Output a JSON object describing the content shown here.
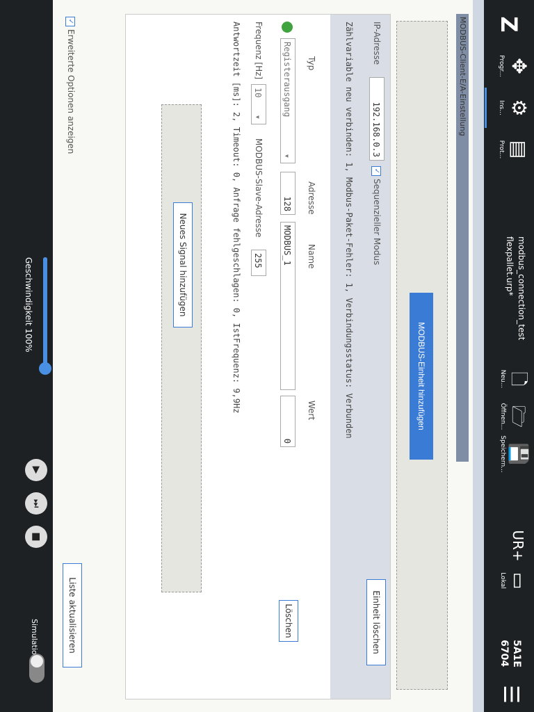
{
  "header": {
    "logo": "Z",
    "tabs": [
      {
        "label": "Progr...",
        "icon": "move"
      },
      {
        "label": "Ins...",
        "icon": "installation"
      },
      {
        "label": "Prot...",
        "icon": "log"
      }
    ],
    "program_name": "modbus_connection_test",
    "installation_name": "flexpallet.urp*",
    "buttons": [
      {
        "label": "Neu...",
        "icon": "new-file"
      },
      {
        "label": "Öffnen...",
        "icon": "open-folder"
      },
      {
        "label": "Speichern...",
        "icon": "save"
      }
    ],
    "plus_icon_label": "",
    "local_label": "Lokal",
    "robot_id_line1": "5A1E",
    "robot_id_line2": "6704"
  },
  "panel": {
    "title": "MODBUS-Client-E/A-Einstellung",
    "add_unit_button": "MODBUS-Einheit hinzufügen"
  },
  "unit": {
    "ip_label": "IP-Adresse",
    "ip_value": "192.168.0.3",
    "seq_mode_label": "Sequenzieller Modus",
    "delete_unit_button": "Einheit löschen",
    "status_line": "Zählvariable neu verbinden:  1, Modbus-Paket-Fehler:  1, Verbindungsstatus: Verbunden",
    "col_typ": "Typ",
    "col_adresse": "Adresse",
    "col_name": "Name",
    "col_wert": "Wert",
    "signal_type": "Registerausgang",
    "signal_address": "128",
    "signal_name": "MODBUS_1",
    "signal_value": "0",
    "delete_signal_button": "Löschen",
    "freq_label": "Frequenz [Hz]",
    "freq_value": "10",
    "slave_label": "MODBUS-Slave-Adresse",
    "slave_value": "255",
    "stats_line": "Antwortzeit [ms]:  2,  Timeout:  0,  Anfrage fehlgeschlagen:  0,  IstFrequenz: 9,9Hz",
    "add_signal_button": "Neues Signal hinzufügen"
  },
  "footer_controls": {
    "advanced_label": "Erweiterte Optionen anzeigen",
    "refresh_button": "Liste aktualisieren"
  },
  "footer": {
    "speed_label": "Geschwindigkeit 100%",
    "speed_fraction": 1.0,
    "simulation_label": "Simulation"
  }
}
